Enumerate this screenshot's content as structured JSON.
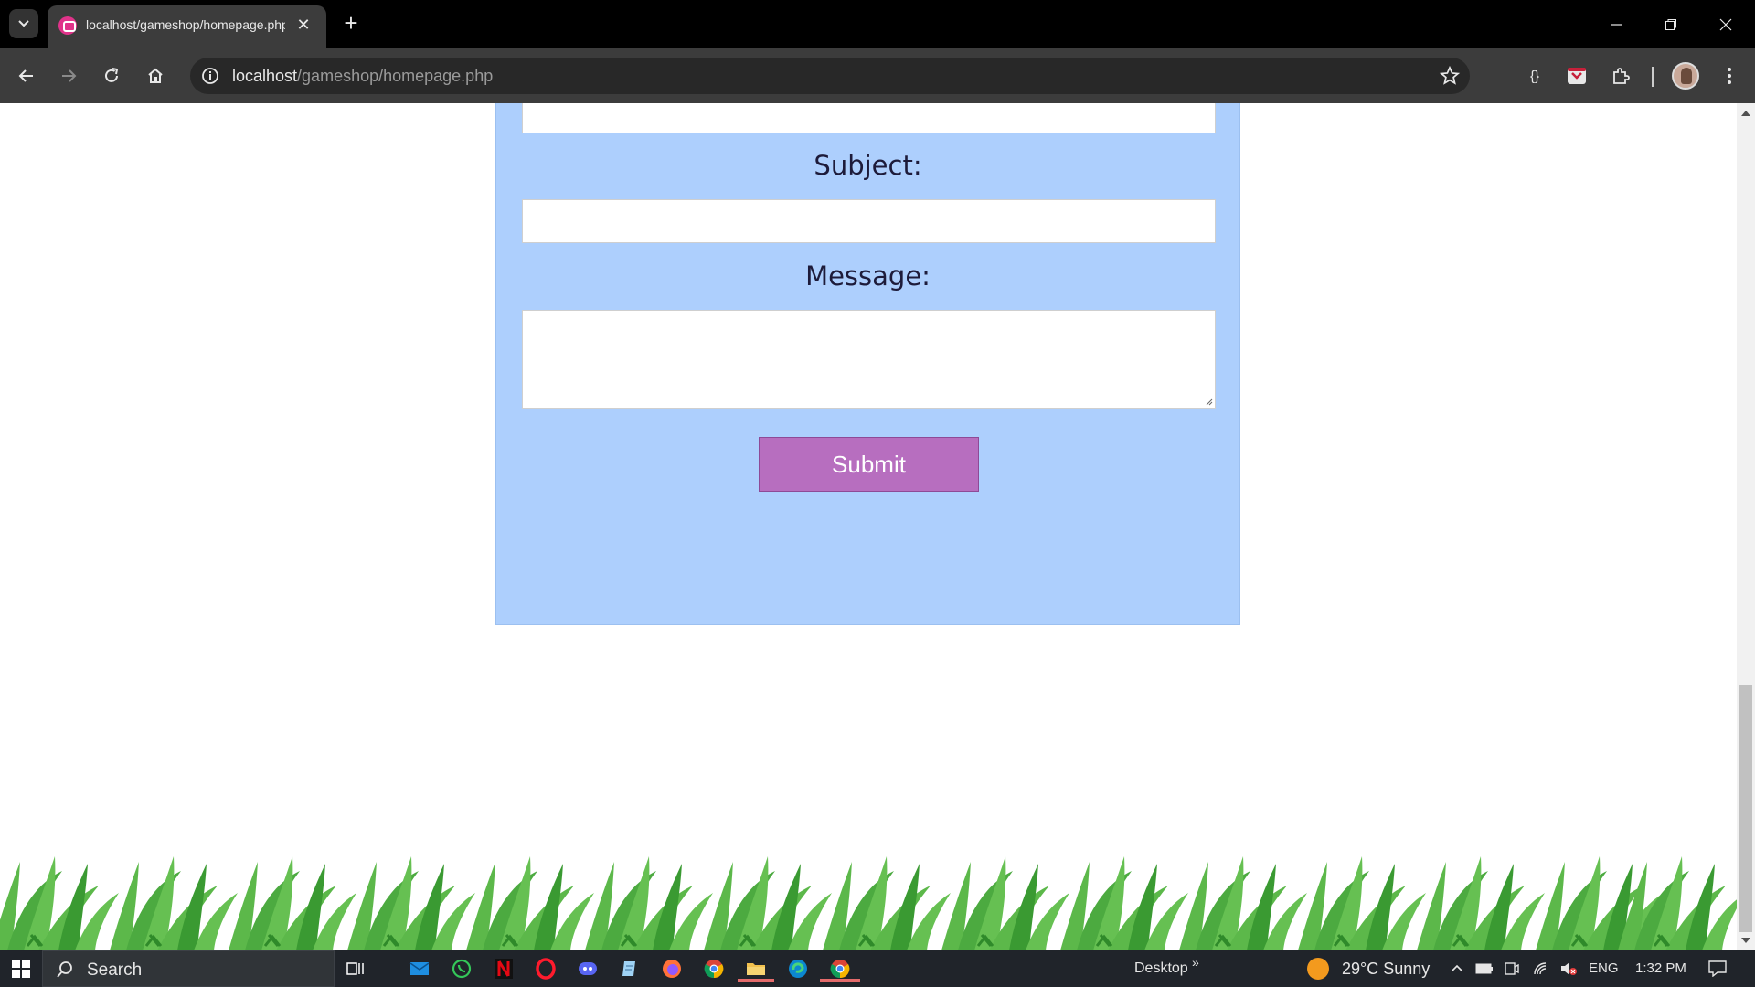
{
  "browser": {
    "tab_title": "localhost/gameshop/homepage.php",
    "url_host": "localhost",
    "url_path": "/gameshop/homepage.php"
  },
  "form": {
    "subject_label": "Subject:",
    "message_label": "Message:",
    "subject_value": "",
    "message_value": "",
    "submit_label": "Submit",
    "card_color": "#adcffd",
    "button_color": "#b76ebf"
  },
  "taskbar": {
    "search_label": "Search",
    "desktop_label": "Desktop",
    "weather_text": "29°C  Sunny",
    "language": "ENG",
    "time": "1:32 PM",
    "pinned_apps": [
      "task-view",
      "mail",
      "whatsapp",
      "netflix",
      "opera",
      "discord",
      "notepad",
      "firefox",
      "chrome",
      "file-explorer",
      "edge",
      "chrome-active"
    ]
  },
  "colors": {
    "grass": "#5cb84a",
    "grass_dark": "#3a9a32"
  }
}
